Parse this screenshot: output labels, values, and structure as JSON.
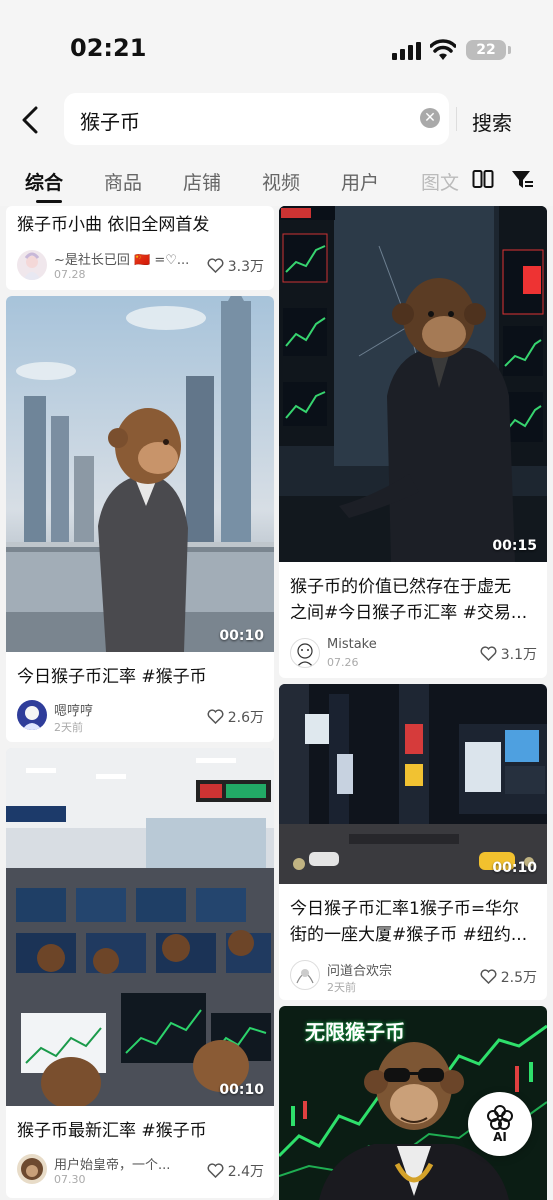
{
  "status": {
    "time": "02:21",
    "battery": "22"
  },
  "search": {
    "query": "猴子币",
    "submit_label": "搜索"
  },
  "tabs": [
    "综合",
    "商品",
    "店铺",
    "视频",
    "用户",
    "图文"
  ],
  "left_column": [
    {
      "title": "猴子币小曲 依旧全网首发",
      "author": "~是社长已回 🇨🇳 =♡...",
      "date": "07.28",
      "likes": "3.3万"
    },
    {
      "title": "今日猴子币汇率 #猴子币",
      "author": "嗯哼哼",
      "date": "2天前",
      "likes": "2.6万",
      "duration": "00:10"
    },
    {
      "title": "猴子币最新汇率 #猴子币",
      "author": "用户始皇帝，一个...",
      "date": "07.30",
      "likes": "2.4万",
      "duration": "00:10"
    }
  ],
  "right_column": [
    {
      "title_line1": "猴子币的价值已然存在于虚无",
      "title_line2": "之间#今日猴子币汇率 #交易...",
      "author": "Mistake",
      "date": "07.26",
      "likes": "3.1万",
      "duration": "00:15"
    },
    {
      "title_line1": "今日猴子币汇率1猴子币=华尔",
      "title_line2": "街的一座大厦#猴子币 #纽约...",
      "author": "问道合欢宗",
      "date": "2天前",
      "likes": "2.5万",
      "duration": "00:10"
    },
    {
      "overlay_text": "无限猴子币"
    }
  ],
  "ai_button": {
    "label": "AI"
  }
}
